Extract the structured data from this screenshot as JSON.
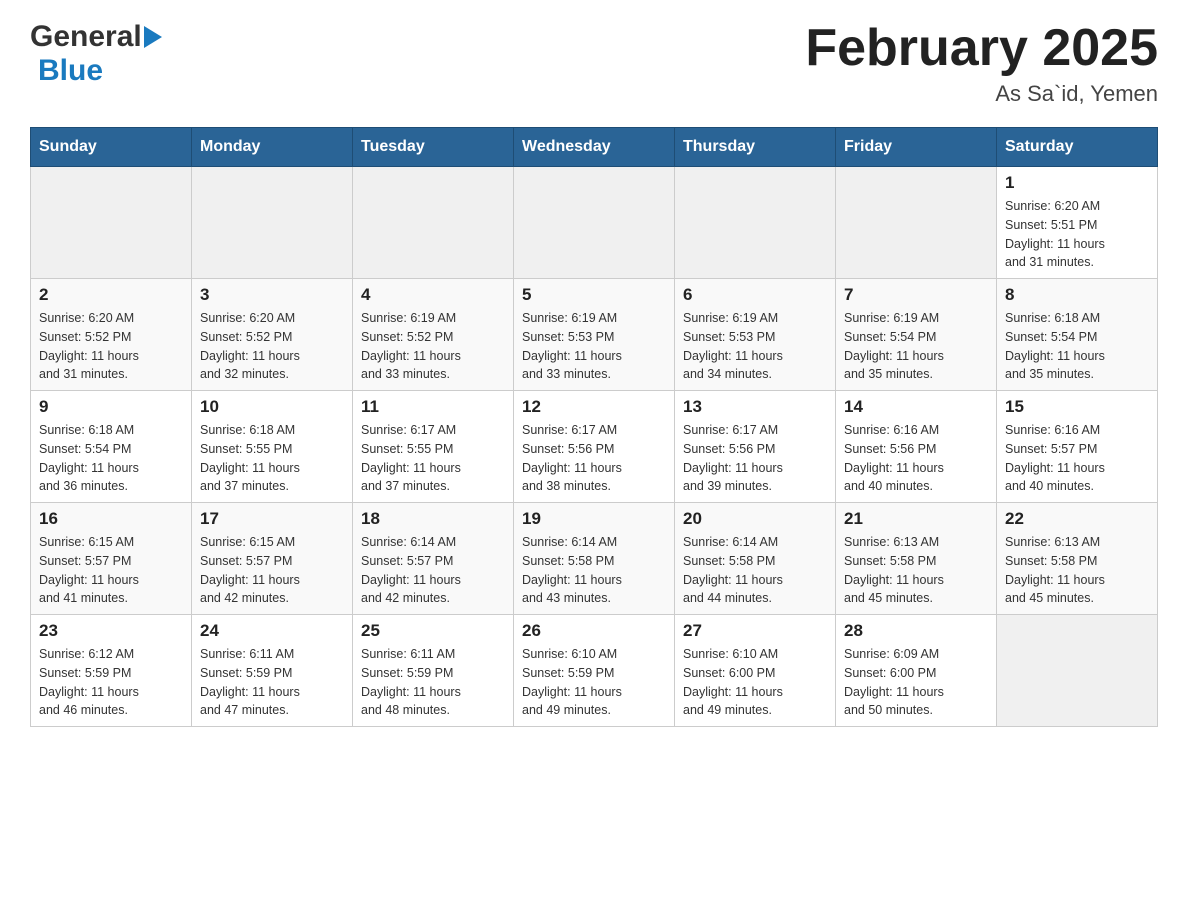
{
  "header": {
    "logo_general": "General",
    "logo_blue": "Blue",
    "month_year": "February 2025",
    "location": "As Sa`id, Yemen"
  },
  "days_of_week": [
    "Sunday",
    "Monday",
    "Tuesday",
    "Wednesday",
    "Thursday",
    "Friday",
    "Saturday"
  ],
  "weeks": [
    [
      {
        "day": "",
        "info": ""
      },
      {
        "day": "",
        "info": ""
      },
      {
        "day": "",
        "info": ""
      },
      {
        "day": "",
        "info": ""
      },
      {
        "day": "",
        "info": ""
      },
      {
        "day": "",
        "info": ""
      },
      {
        "day": "1",
        "info": "Sunrise: 6:20 AM\nSunset: 5:51 PM\nDaylight: 11 hours\nand 31 minutes."
      }
    ],
    [
      {
        "day": "2",
        "info": "Sunrise: 6:20 AM\nSunset: 5:52 PM\nDaylight: 11 hours\nand 31 minutes."
      },
      {
        "day": "3",
        "info": "Sunrise: 6:20 AM\nSunset: 5:52 PM\nDaylight: 11 hours\nand 32 minutes."
      },
      {
        "day": "4",
        "info": "Sunrise: 6:19 AM\nSunset: 5:52 PM\nDaylight: 11 hours\nand 33 minutes."
      },
      {
        "day": "5",
        "info": "Sunrise: 6:19 AM\nSunset: 5:53 PM\nDaylight: 11 hours\nand 33 minutes."
      },
      {
        "day": "6",
        "info": "Sunrise: 6:19 AM\nSunset: 5:53 PM\nDaylight: 11 hours\nand 34 minutes."
      },
      {
        "day": "7",
        "info": "Sunrise: 6:19 AM\nSunset: 5:54 PM\nDaylight: 11 hours\nand 35 minutes."
      },
      {
        "day": "8",
        "info": "Sunrise: 6:18 AM\nSunset: 5:54 PM\nDaylight: 11 hours\nand 35 minutes."
      }
    ],
    [
      {
        "day": "9",
        "info": "Sunrise: 6:18 AM\nSunset: 5:54 PM\nDaylight: 11 hours\nand 36 minutes."
      },
      {
        "day": "10",
        "info": "Sunrise: 6:18 AM\nSunset: 5:55 PM\nDaylight: 11 hours\nand 37 minutes."
      },
      {
        "day": "11",
        "info": "Sunrise: 6:17 AM\nSunset: 5:55 PM\nDaylight: 11 hours\nand 37 minutes."
      },
      {
        "day": "12",
        "info": "Sunrise: 6:17 AM\nSunset: 5:56 PM\nDaylight: 11 hours\nand 38 minutes."
      },
      {
        "day": "13",
        "info": "Sunrise: 6:17 AM\nSunset: 5:56 PM\nDaylight: 11 hours\nand 39 minutes."
      },
      {
        "day": "14",
        "info": "Sunrise: 6:16 AM\nSunset: 5:56 PM\nDaylight: 11 hours\nand 40 minutes."
      },
      {
        "day": "15",
        "info": "Sunrise: 6:16 AM\nSunset: 5:57 PM\nDaylight: 11 hours\nand 40 minutes."
      }
    ],
    [
      {
        "day": "16",
        "info": "Sunrise: 6:15 AM\nSunset: 5:57 PM\nDaylight: 11 hours\nand 41 minutes."
      },
      {
        "day": "17",
        "info": "Sunrise: 6:15 AM\nSunset: 5:57 PM\nDaylight: 11 hours\nand 42 minutes."
      },
      {
        "day": "18",
        "info": "Sunrise: 6:14 AM\nSunset: 5:57 PM\nDaylight: 11 hours\nand 42 minutes."
      },
      {
        "day": "19",
        "info": "Sunrise: 6:14 AM\nSunset: 5:58 PM\nDaylight: 11 hours\nand 43 minutes."
      },
      {
        "day": "20",
        "info": "Sunrise: 6:14 AM\nSunset: 5:58 PM\nDaylight: 11 hours\nand 44 minutes."
      },
      {
        "day": "21",
        "info": "Sunrise: 6:13 AM\nSunset: 5:58 PM\nDaylight: 11 hours\nand 45 minutes."
      },
      {
        "day": "22",
        "info": "Sunrise: 6:13 AM\nSunset: 5:58 PM\nDaylight: 11 hours\nand 45 minutes."
      }
    ],
    [
      {
        "day": "23",
        "info": "Sunrise: 6:12 AM\nSunset: 5:59 PM\nDaylight: 11 hours\nand 46 minutes."
      },
      {
        "day": "24",
        "info": "Sunrise: 6:11 AM\nSunset: 5:59 PM\nDaylight: 11 hours\nand 47 minutes."
      },
      {
        "day": "25",
        "info": "Sunrise: 6:11 AM\nSunset: 5:59 PM\nDaylight: 11 hours\nand 48 minutes."
      },
      {
        "day": "26",
        "info": "Sunrise: 6:10 AM\nSunset: 5:59 PM\nDaylight: 11 hours\nand 49 minutes."
      },
      {
        "day": "27",
        "info": "Sunrise: 6:10 AM\nSunset: 6:00 PM\nDaylight: 11 hours\nand 49 minutes."
      },
      {
        "day": "28",
        "info": "Sunrise: 6:09 AM\nSunset: 6:00 PM\nDaylight: 11 hours\nand 50 minutes."
      },
      {
        "day": "",
        "info": ""
      }
    ]
  ]
}
